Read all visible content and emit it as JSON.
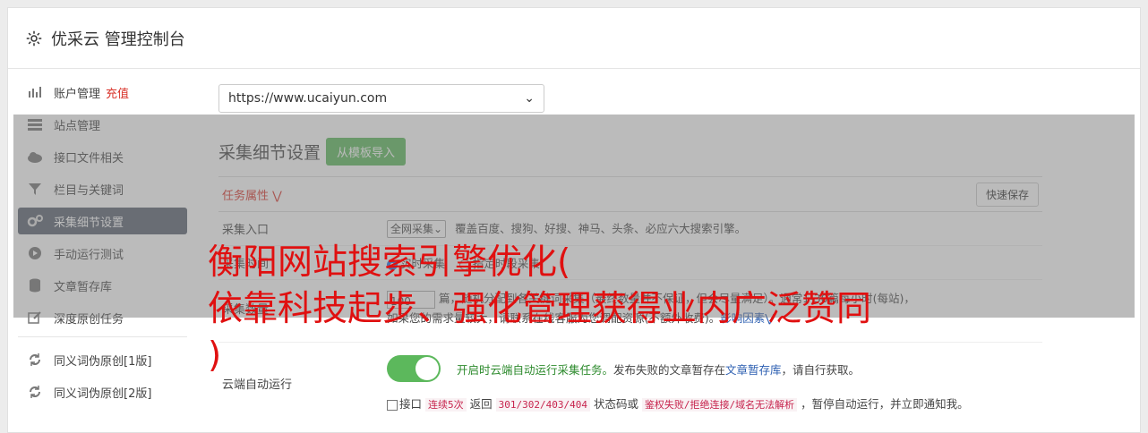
{
  "header": {
    "title": "优采云 管理控制台",
    "icon": "gear-icon"
  },
  "sidebar": {
    "items": [
      {
        "label": "账户管理",
        "extra": "充值",
        "icon": "bar-chart-icon"
      },
      {
        "label": "站点管理",
        "icon": "server-icon"
      },
      {
        "label": "接口文件相关",
        "icon": "cloud-upload-icon"
      },
      {
        "label": "栏目与关键词",
        "icon": "filter-icon"
      },
      {
        "label": "采集细节设置",
        "icon": "gears-icon",
        "active": true
      },
      {
        "label": "手动运行测试",
        "icon": "play-circle-icon"
      },
      {
        "label": "文章暂存库",
        "icon": "database-icon"
      },
      {
        "label": "深度原创任务",
        "icon": "edit-icon"
      },
      {
        "label": "同义词伪原创[1版]",
        "icon": "refresh-icon"
      },
      {
        "label": "同义词伪原创[2版]",
        "icon": "refresh-icon"
      }
    ]
  },
  "main": {
    "site_select": "https://www.ucaiyun.com",
    "section_title": "采集细节设置",
    "import_button": "从模板导入",
    "task_props": "任务属性",
    "quick_save": "快速保存",
    "rows": {
      "entry": {
        "label": "采集入口",
        "select": "全网采集",
        "desc": "覆盖百度、搜狗、好搜、神马、头条、必应六大搜索引擎。"
      },
      "time": {
        "label": "采集时间",
        "opt1": "实时采集",
        "opt2": "指定时段采集"
      },
      "count": {
        "label": "采集数量",
        "value": "100",
        "desc1": "篇，随机分配到各关键词采集（最终数量并不保证，但会尽量满足）。通常1-30篇每小时(每站)，",
        "desc2": "如果您的需求量较大，请联系在线客服为您调配资源(不额外收费)。",
        "link": "影响因素"
      },
      "cloud": {
        "label": "云端自动运行",
        "on_text": "开启时云端自动运行采集任务。",
        "desc": "发布失败的文章暂存在",
        "link": "文章暂存库",
        "desc_end": "，请自行获取。"
      },
      "api": {
        "checkbox_label": "接口",
        "code1": "连续5次",
        "text1": "返回",
        "code2": "301/302/403/404",
        "text2": "状态码或",
        "code3": "鉴权失败/拒绝连接/域名无法解析",
        "text3": "，暂停自动运行，并立即通知我。"
      }
    }
  },
  "overlay_text": {
    "line1": "衡阳网站搜索引擎优化(",
    "line2": "依靠科技起步、强化管理获得业内广泛赞同",
    "line3": ")"
  },
  "colors": {
    "accent_green": "#5cb85c",
    "active_bg": "#5a6270",
    "red": "#d9342b",
    "link": "#2a5db0"
  }
}
